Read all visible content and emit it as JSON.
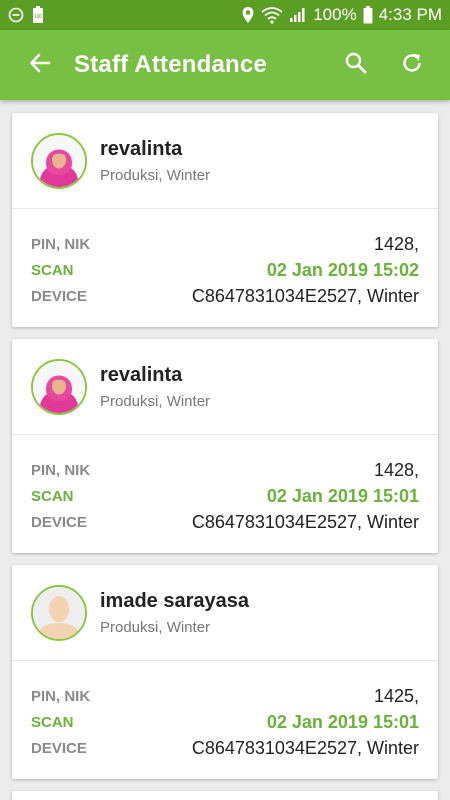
{
  "status_bar": {
    "battery_text": "100%",
    "time": "4:33 PM",
    "icons": [
      "minus-circle-icon",
      "battery-100-icon",
      "location-icon",
      "wifi-icon",
      "signal-icon",
      "battery-icon"
    ]
  },
  "app_bar": {
    "title": "Staff Attendance",
    "color": "#77c043",
    "icons": [
      "back-arrow-icon",
      "search-icon",
      "refresh-icon"
    ]
  },
  "labels": {
    "pin": "PIN, NIK",
    "scan": "SCAN",
    "device": "DEVICE"
  },
  "records": [
    {
      "name": "revalinta",
      "dept": "Produksi, Winter",
      "pin": "1428,",
      "scan": "02 Jan 2019 15:02",
      "device": "C8647831034E2527, Winter",
      "avatar": "photo-hijab"
    },
    {
      "name": "revalinta",
      "dept": "Produksi, Winter",
      "pin": "1428,",
      "scan": "02 Jan 2019 15:01",
      "device": "C8647831034E2527, Winter",
      "avatar": "photo-hijab"
    },
    {
      "name": "imade sarayasa",
      "dept": "Produksi, Winter",
      "pin": "1425,",
      "scan": "02 Jan 2019 15:01",
      "device": "C8647831034E2527, Winter",
      "avatar": "default-person"
    }
  ],
  "accent_color": "#6ab23a"
}
